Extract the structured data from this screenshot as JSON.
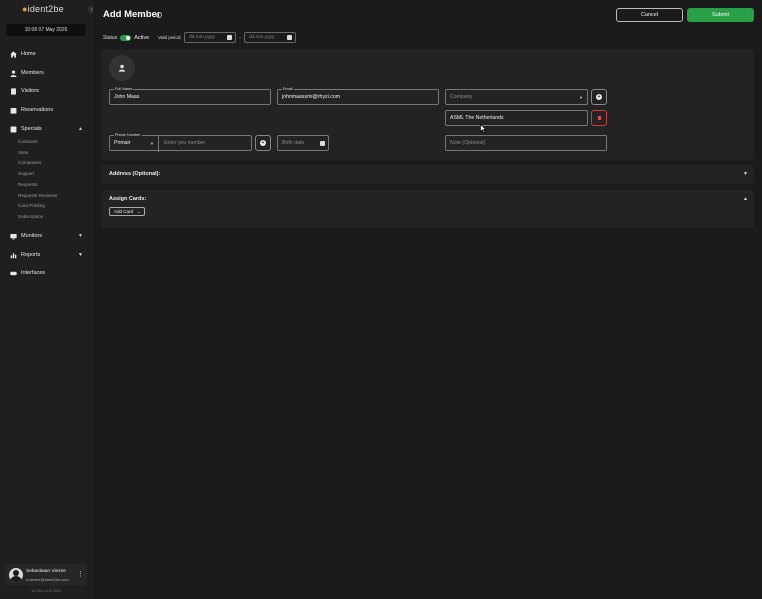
{
  "sidebar": {
    "logo_text": "ident2be",
    "collapse_icon": "chevron-left-icon",
    "clock": "10:08  07 May 2026",
    "nav": [
      {
        "label": "Home",
        "icon": "home-icon"
      },
      {
        "label": "Members",
        "icon": "person-icon"
      },
      {
        "label": "Visitors",
        "icon": "badge-icon"
      },
      {
        "label": "Reservations",
        "icon": "calendar-icon"
      },
      {
        "label": "Specials",
        "icon": "grid-icon"
      },
      {
        "label": "Monitors",
        "icon": "monitor-icon"
      },
      {
        "label": "Reports",
        "icon": "report-icon"
      },
      {
        "label": "Interfaces",
        "icon": "toggle-icon"
      }
    ],
    "specials_sub": [
      "Contracts",
      "Sites",
      "Companies",
      "Support",
      "Requests",
      "Requests Reviewer",
      "Card Printing",
      "Subscription"
    ],
    "user": {
      "name": "Sebastiaan Viezee",
      "email": "s.viezee@ident2be.com"
    },
    "version": "v2.28.x rc.D-1050"
  },
  "header": {
    "title": "Add Member",
    "cancel_label": "Cancel",
    "submit_label": "Submit"
  },
  "status": {
    "label": "Status",
    "value": "Active",
    "valid_period_label": "Valid period:",
    "from_placeholder": "dd.mm.yyyy",
    "to_placeholder": "dd.mm.yyyy",
    "separator": "-"
  },
  "form": {
    "full_name_label": "Full Name",
    "full_name_value": "John Maas",
    "email_label": "Email",
    "email_value": "johnmaassmi@rhyzi.com",
    "company_placeholder": "Company",
    "company_item": "ASML The Netherlands",
    "phone_label": "Phone Number",
    "phone_type": "Primair",
    "phone_placeholder": "Enter you number",
    "birth_placeholder": "Birth date",
    "note_placeholder": "Note (Optional)"
  },
  "sections": {
    "address_title": "Address (Optional):",
    "cards_title": "Assign Cards:",
    "add_card_label": "Add Card"
  },
  "colors": {
    "accent_green": "#27a046",
    "delete_red": "#d23b3b",
    "logo_orange": "#e8a21b"
  }
}
